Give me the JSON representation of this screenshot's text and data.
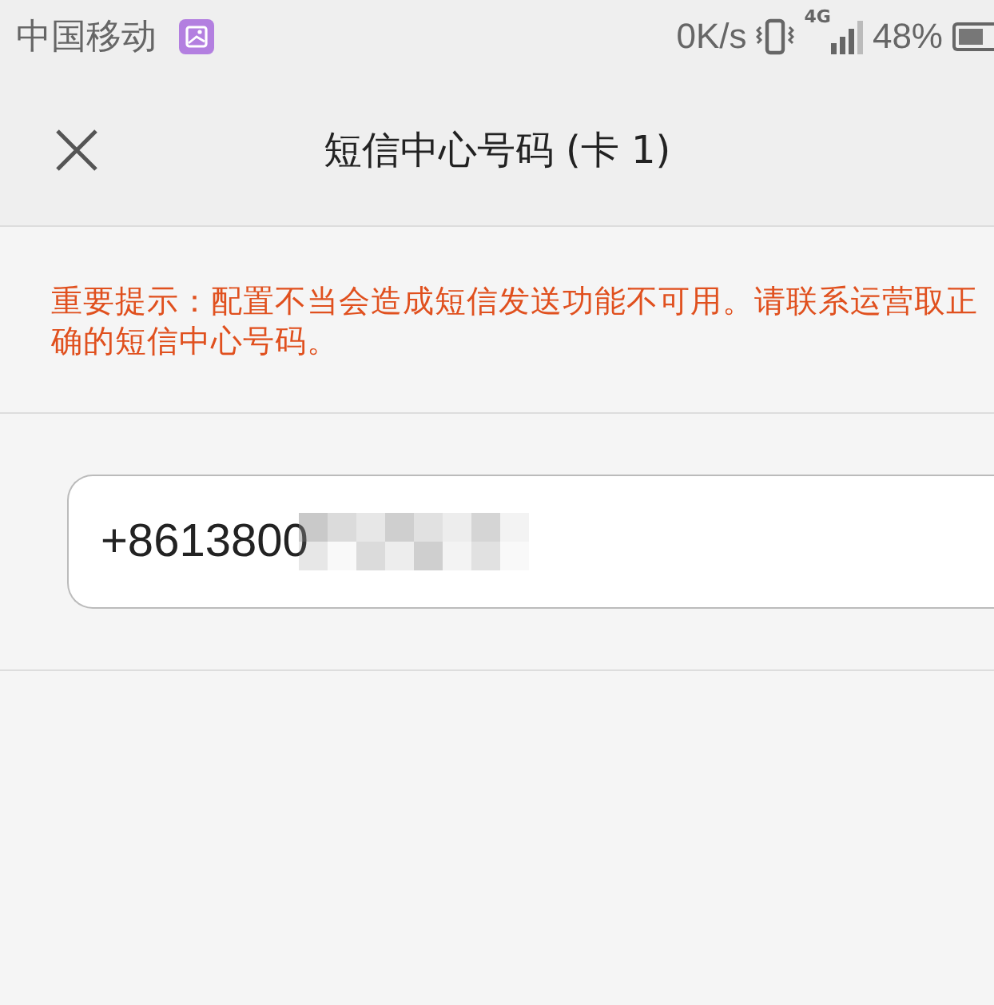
{
  "status_bar": {
    "carrier": "中国移动",
    "speed": "0K/s",
    "network": "4G",
    "battery": "48%"
  },
  "header": {
    "title": "短信中心号码 (卡 1)"
  },
  "notice": "重要提示：配置不当会造成短信发送功能不可用。请联系运营取正确的短信中心号码。",
  "number_field": {
    "value": "+8613800"
  }
}
